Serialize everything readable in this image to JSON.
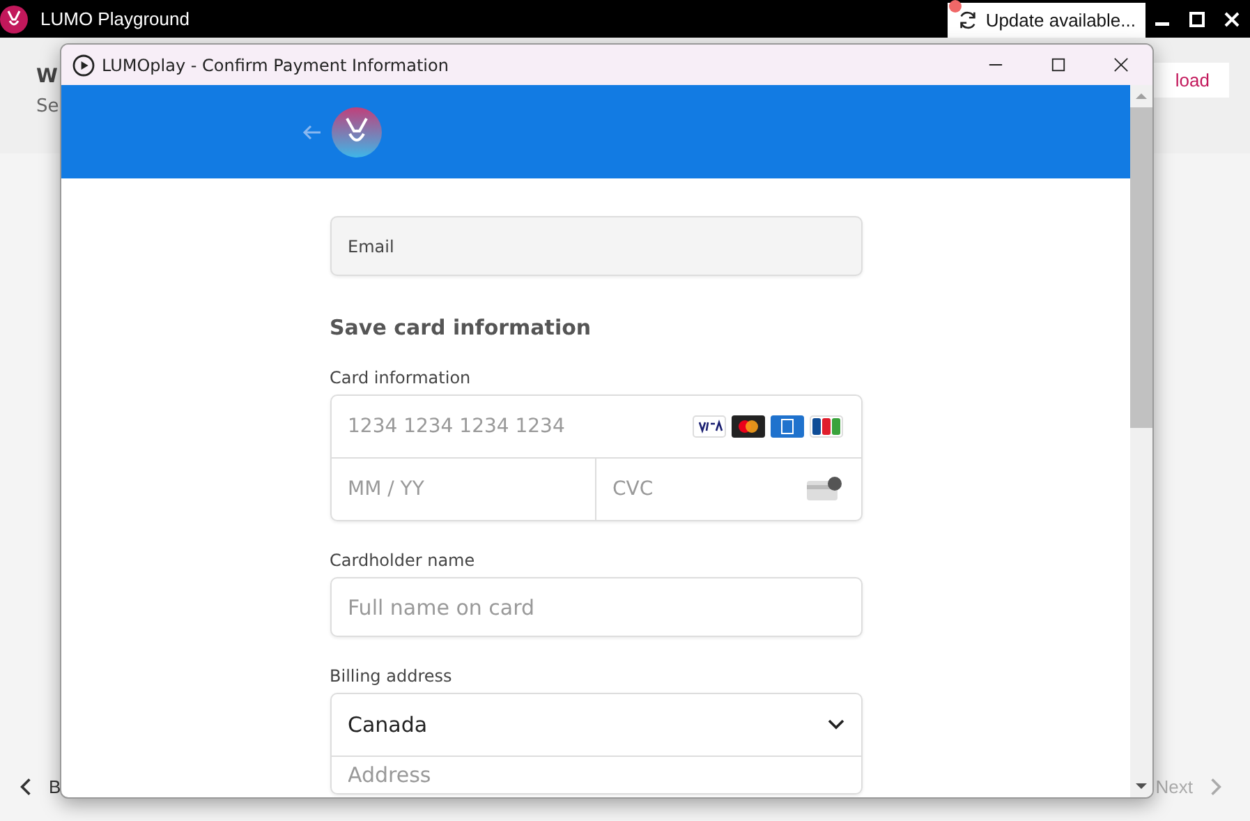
{
  "app": {
    "title": "LUMO Playground",
    "update_button": "Update available..."
  },
  "background_page": {
    "heading": "W",
    "subtitle": "Se",
    "action_button": "load",
    "back_button": "B",
    "next_button": {
      "label": "Next",
      "disabled": true
    }
  },
  "dialog": {
    "title": "LUMOplay - Confirm Payment Information"
  },
  "form": {
    "email": {
      "placeholder": "Email"
    },
    "section_title": "Save card information",
    "card_label": "Card information",
    "card_number": {
      "placeholder": "1234 1234 1234 1234"
    },
    "expiry": {
      "placeholder": "MM / YY"
    },
    "cvc": {
      "placeholder": "CVC"
    },
    "cardholder_label": "Cardholder name",
    "cardholder": {
      "placeholder": "Full name on card"
    },
    "billing_label": "Billing address",
    "country": {
      "value": "Canada"
    },
    "address": {
      "placeholder": "Address"
    }
  }
}
